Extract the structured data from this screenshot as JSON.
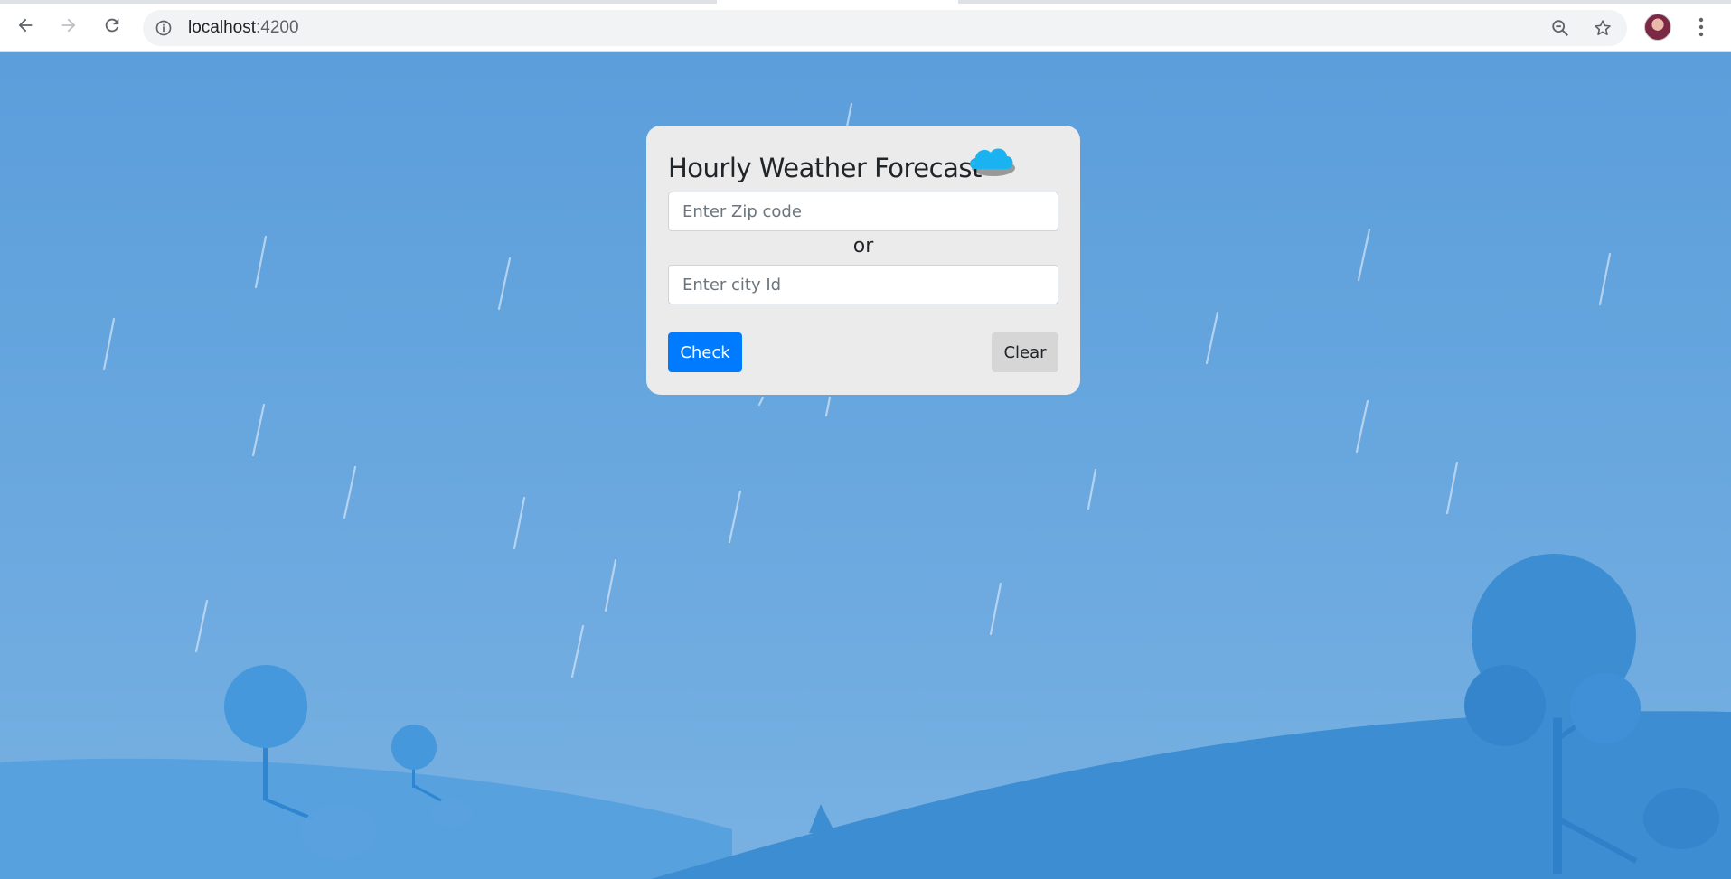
{
  "browser": {
    "url_host": "localhost",
    "url_port": ":4200",
    "icons": {
      "back": "arrow-left-icon",
      "forward": "arrow-right-icon",
      "reload": "reload-icon",
      "info": "info-icon",
      "zoom": "zoom-out-icon",
      "bookmark": "star-icon",
      "menu": "kebab-menu-icon"
    }
  },
  "card": {
    "title": "Hourly Weather Forecast",
    "title_icon": "cloud-icon",
    "zip_placeholder": "Enter Zip code",
    "separator": "or",
    "city_placeholder": "Enter city Id",
    "check_label": "Check",
    "clear_label": "Clear"
  },
  "colors": {
    "sky": "#5b9edb",
    "card_bg": "#ebebeb",
    "primary": "#007bff",
    "secondary": "#d6d6d6",
    "cloud": "#1ab2f0"
  }
}
